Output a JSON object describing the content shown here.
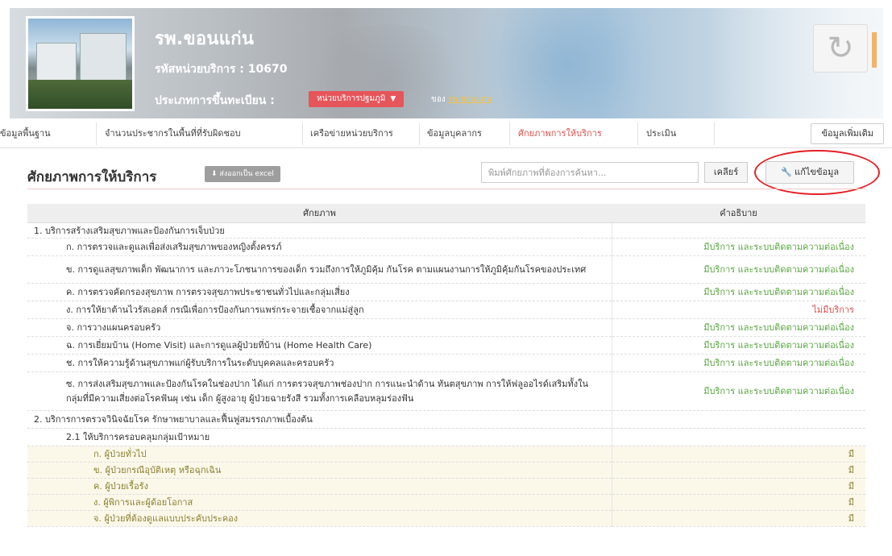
{
  "header": {
    "name": "รพ.ขอนแก่น",
    "code": "รหัสหน่วยบริการ : 10670",
    "type_label": "ประเภทการขึ้นทะเบียน :",
    "type_badge": "หน่วยบริการปฐมภูมิ",
    "network_prefix": "ของ",
    "network_link": "รพ.ขอนแก่น",
    "refresh_icon": "↻"
  },
  "tabs": [
    {
      "label": "ข้อมูลพื้นฐาน"
    },
    {
      "label": "จำนวนประชากรในพื้นที่ที่รับผิดชอบ"
    },
    {
      "label": "เครือข่ายหน่วยบริการ"
    },
    {
      "label": "ข้อมูลบุคลากร"
    },
    {
      "label": "ศักยภาพการให้บริการ"
    },
    {
      "label": "ประเมิน"
    }
  ],
  "more_tab": "ข้อมูลเพิ่มเติม",
  "section": {
    "title": "ศักยภาพการให้บริการ",
    "export": "ส่งออกเป็น excel",
    "search_placeholder": "พิมพ์ศักยภาพที่ต้องการค้นหา...",
    "clear": "เคลียร์",
    "edit": "แก้ไขข้อมูล"
  },
  "table": {
    "headers": [
      "ศักยภาพ",
      "คำอธิบาย"
    ],
    "rows": [
      {
        "label": "1. บริการสร้างเสริมสุขภาพและป้องกันการเจ็บป่วย",
        "value": "",
        "level": 0
      },
      {
        "label": "ก. การตรวจและดูแลเพื่อส่งเสริมสุขภาพของหญิงตั้งครรภ์",
        "value": "มีบริการ และระบบติดตามความต่อเนื่อง",
        "level": 1
      },
      {
        "label": "ข. การดูแลสุขภาพเด็ก พัฒนาการ และภาวะโภชนาการของเด็ก รวมถึงการให้ภูมิคุ้ม กันโรค ตามแผนงานการให้ภูมิคุ้มกันโรคของประเทศ",
        "value": "มีบริการ และระบบติดตามความต่อเนื่อง",
        "level": 1
      },
      {
        "label": "ค. การตรวจคัดกรองสุขภาพ การตรวจสุขภาพประชาชนทั่วไปและกลุ่มเสี่ยง",
        "value": "มีบริการ และระบบติดตามความต่อเนื่อง",
        "level": 1
      },
      {
        "label": "ง. การให้ยาต้านไวรัสเอดส์ กรณีเพื่อการป้องกันการแพร่กระจายเชื้อจากแม่สู่ลูก",
        "value": "ไม่มีบริการ",
        "level": 1
      },
      {
        "label": "จ. การวางแผนครอบครัว",
        "value": "มีบริการ และระบบติดตามความต่อเนื่อง",
        "level": 1
      },
      {
        "label": "ฉ. การเยี่ยมบ้าน (Home Visit) และการดูแลผู้ป่วยที่บ้าน (Home Health Care)",
        "value": "มีบริการ และระบบติดตามความต่อเนื่อง",
        "level": 1
      },
      {
        "label": "ช. การให้ความรู้ด้านสุขภาพแก่ผู้รับบริการในระดับบุคคลและครอบครัว",
        "value": "มีบริการ และระบบติดตามความต่อเนื่อง",
        "level": 1
      },
      {
        "label": "ซ. การส่งเสริมสุขภาพและป้องกันโรคในช่องปาก ได้แก่ การตรวจสุขภาพช่องปาก การแนะนำด้าน ทันตสุขภาพ การให้ฟลูออไรด์เสริมทั้งในกลุ่มที่มีความเสี่ยงต่อโรคฟันผุ เช่น เด็ก ผู้สูงอายุ ผู้ป่วยฉายรังสี รวมทั้งการเคลือบหลุมร่องฟัน",
        "value": "มีบริการ และระบบติดตามความต่อเนื่อง",
        "level": 1
      },
      {
        "label": "2. บริการการตรวจวินิจฉัยโรค รักษาพยาบาลและฟื้นฟูสมรรถภาพเบื้องต้น",
        "value": "",
        "level": 0
      },
      {
        "label": "2.1 ให้บริการครอบคลุมกลุ่มเป้าหมาย",
        "value": "",
        "level": 1
      },
      {
        "label": "ก. ผู้ป่วยทั่วไป",
        "value": "มี",
        "level": 2
      },
      {
        "label": "ข. ผู้ป่วยกรณีอุบัติเหตุ หรือฉุกเฉิน",
        "value": "มี",
        "level": 2
      },
      {
        "label": "ค. ผู้ป่วยเรื้อรัง",
        "value": "มี",
        "level": 2
      },
      {
        "label": "ง. ผู้พิการและผู้ด้อยโอกาส",
        "value": "มี",
        "level": 2
      },
      {
        "label": "จ. ผู้ป่วยที่ต้องดูแลแบบประคับประคอง",
        "value": "มี",
        "level": 2
      }
    ]
  }
}
